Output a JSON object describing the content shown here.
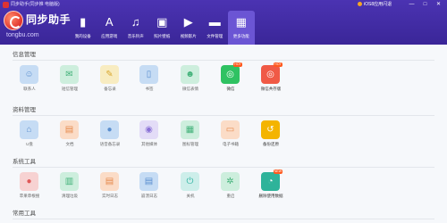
{
  "window": {
    "title": "同步助手(同步推 电脑版)",
    "ios_repair": "iOS8应用闪退",
    "minimize": "—",
    "maximize": "□",
    "close": "✕"
  },
  "logo": {
    "name": "同步助手",
    "url": "tongbu.com"
  },
  "nav": [
    {
      "label": "我的设备",
      "icon": "phone-icon",
      "glyph": "▮",
      "active": false
    },
    {
      "label": "应用游戏",
      "icon": "app-store-icon",
      "glyph": "A",
      "active": false
    },
    {
      "label": "音乐铃声",
      "icon": "music-note-icon",
      "glyph": "♫",
      "active": false
    },
    {
      "label": "照片壁纸",
      "icon": "image-icon",
      "glyph": "▣",
      "active": false
    },
    {
      "label": "视频影片",
      "icon": "film-icon",
      "glyph": "▶",
      "active": false
    },
    {
      "label": "文件管理",
      "icon": "folder-icon",
      "glyph": "▬",
      "active": false
    },
    {
      "label": "更多功能",
      "icon": "grid-icon",
      "glyph": "▦",
      "active": true
    }
  ],
  "sections": [
    {
      "title": "信息管理",
      "items": [
        {
          "label": "联系人",
          "icon": "contacts-icon",
          "glyph": "☺",
          "style": "bluish"
        },
        {
          "label": "短信管理",
          "icon": "sms-icon",
          "glyph": "✉",
          "style": "green-l"
        },
        {
          "label": "备忘录",
          "icon": "memo-icon",
          "glyph": "✎",
          "style": "yellow-l"
        },
        {
          "label": "书签",
          "icon": "bookmark-icon",
          "glyph": "▯",
          "style": "bluish"
        },
        {
          "label": "微信表情",
          "icon": "emoji-icon",
          "glyph": "☻",
          "style": "green-l"
        },
        {
          "label": "微信",
          "icon": "wechat-icon",
          "glyph": "◎",
          "style": "green-s",
          "badge": "HOT"
        },
        {
          "label": "微信共存版",
          "icon": "wechat-dual-icon",
          "glyph": "◎",
          "style": "red-s",
          "badge": "HOT"
        }
      ]
    },
    {
      "title": "资料管理",
      "items": [
        {
          "label": "U盘",
          "icon": "usb-icon",
          "glyph": "⌂",
          "style": "bluish"
        },
        {
          "label": "文档",
          "icon": "document-icon",
          "glyph": "▤",
          "style": "orange-l"
        },
        {
          "label": "语音备忘录",
          "icon": "microphone-icon",
          "glyph": "●",
          "style": "bluish"
        },
        {
          "label": "其他媒体",
          "icon": "podcast-icon",
          "glyph": "◉",
          "style": "purple-l"
        },
        {
          "label": "图标管理",
          "icon": "icon-grid-icon",
          "glyph": "▦",
          "style": "green-l"
        },
        {
          "label": "电子书籍",
          "icon": "ebook-icon",
          "glyph": "▭",
          "style": "orange-l"
        },
        {
          "label": "备份还原",
          "icon": "backup-icon",
          "glyph": "↺",
          "style": "yellow-s"
        }
      ]
    },
    {
      "title": "系统工具",
      "items": [
        {
          "label": "苹果草根搜",
          "icon": "apple-icon",
          "glyph": "●",
          "style": "red-l"
        },
        {
          "label": "清理垃圾",
          "icon": "trash-icon",
          "glyph": "▥",
          "style": "green-l"
        },
        {
          "label": "实时日志",
          "icon": "log-icon",
          "glyph": "▤",
          "style": "orange-l"
        },
        {
          "label": "崩溃日志",
          "icon": "crash-log-icon",
          "glyph": "▤",
          "style": "bluish"
        },
        {
          "label": "关机",
          "icon": "power-icon",
          "glyph": "⏻",
          "style": "cyan-l"
        },
        {
          "label": "重启",
          "icon": "restart-icon",
          "glyph": "✲",
          "style": "green-l"
        },
        {
          "label": "删除使用数据",
          "icon": "pie-chart-icon",
          "glyph": "◔",
          "style": "teal-s",
          "badge": "NEW"
        }
      ]
    },
    {
      "title": "常用工具",
      "items": []
    }
  ]
}
